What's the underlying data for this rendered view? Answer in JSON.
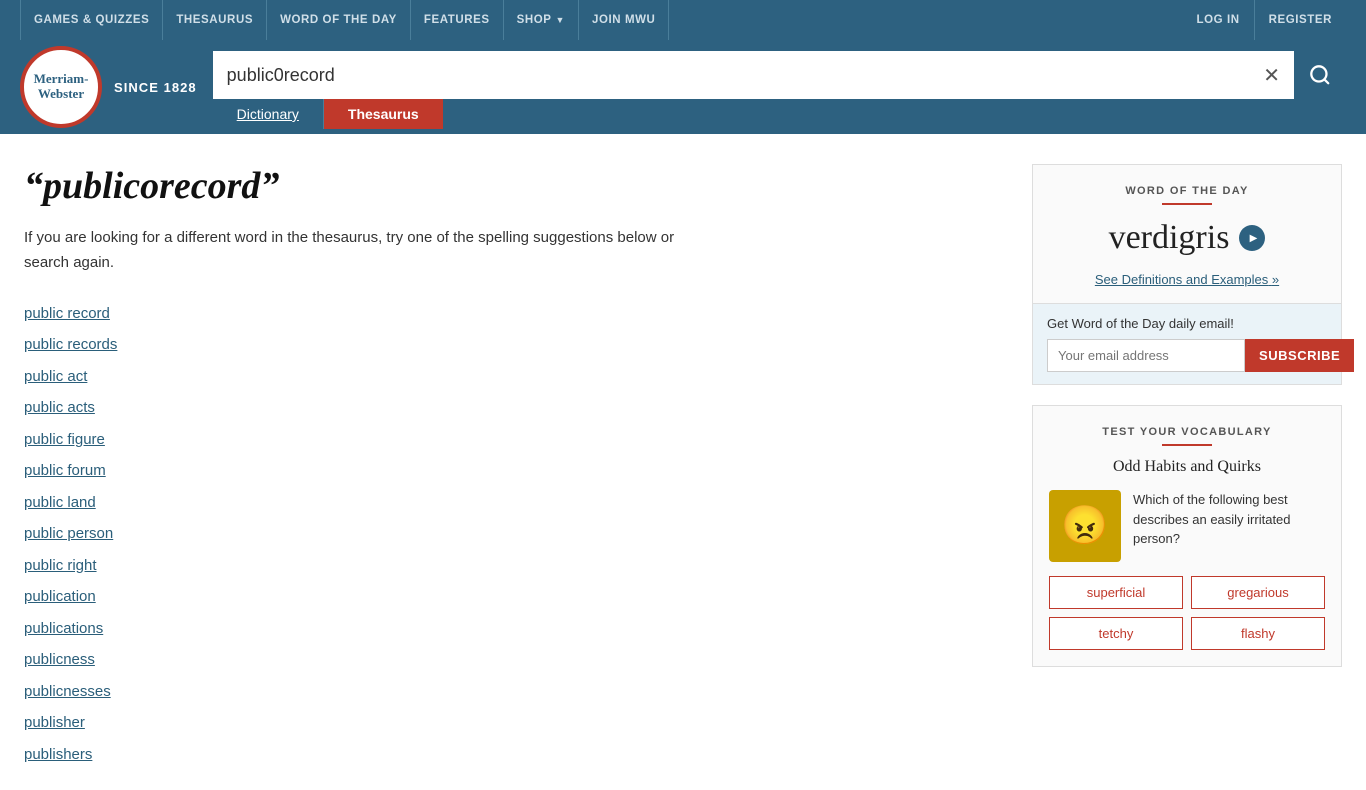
{
  "topNav": {
    "links": [
      {
        "label": "GAMES & QUIZZES",
        "id": "games-quizzes"
      },
      {
        "label": "THESAURUS",
        "id": "thesaurus-nav"
      },
      {
        "label": "WORD OF THE DAY",
        "id": "word-of-the-day-nav"
      },
      {
        "label": "FEATURES",
        "id": "features-nav"
      },
      {
        "label": "SHOP",
        "id": "shop-nav"
      },
      {
        "label": "JOIN MWU",
        "id": "join-mwu-nav"
      }
    ],
    "loginLabel": "LOG IN",
    "registerLabel": "REGISTER"
  },
  "header": {
    "logoLine1": "Merriam-",
    "logoLine2": "Webster",
    "since": "SINCE 1828",
    "searchValue": "public0record",
    "tabDict": "Dictionary",
    "tabThes": "Thesaurus"
  },
  "mainContent": {
    "title": "“publicorecord”",
    "suggestionText": "If you are looking for a different word in the thesaurus, try one of the spelling suggestions below or search again.",
    "wordList": [
      "public record",
      "public records",
      "public act",
      "public acts",
      "public figure",
      "public forum",
      "public land",
      "public person",
      "public right",
      "publication",
      "publications",
      "publicness",
      "publicnesses",
      "publisher",
      "publishers"
    ]
  },
  "sidebar": {
    "wotd": {
      "sectionLabel": "WORD OF THE DAY",
      "word": "verdigris",
      "definitionLink": "See Definitions and Examples",
      "definitionArrow": "»",
      "emailLabel": "Get Word of the Day daily email!",
      "emailPlaceholder": "Your email address",
      "subscribeLabel": "SUBSCRIBE"
    },
    "vocab": {
      "sectionLabel": "TEST YOUR VOCABULARY",
      "title": "Odd Habits and Quirks",
      "question": "Which of the following best describes an easily irritated person?",
      "emoji": "😠",
      "options": [
        {
          "label": "superficial",
          "id": "opt-superficial"
        },
        {
          "label": "gregarious",
          "id": "opt-gregarious"
        },
        {
          "label": "tetchy",
          "id": "opt-tetchy"
        },
        {
          "label": "flashy",
          "id": "opt-flashy"
        }
      ]
    }
  }
}
